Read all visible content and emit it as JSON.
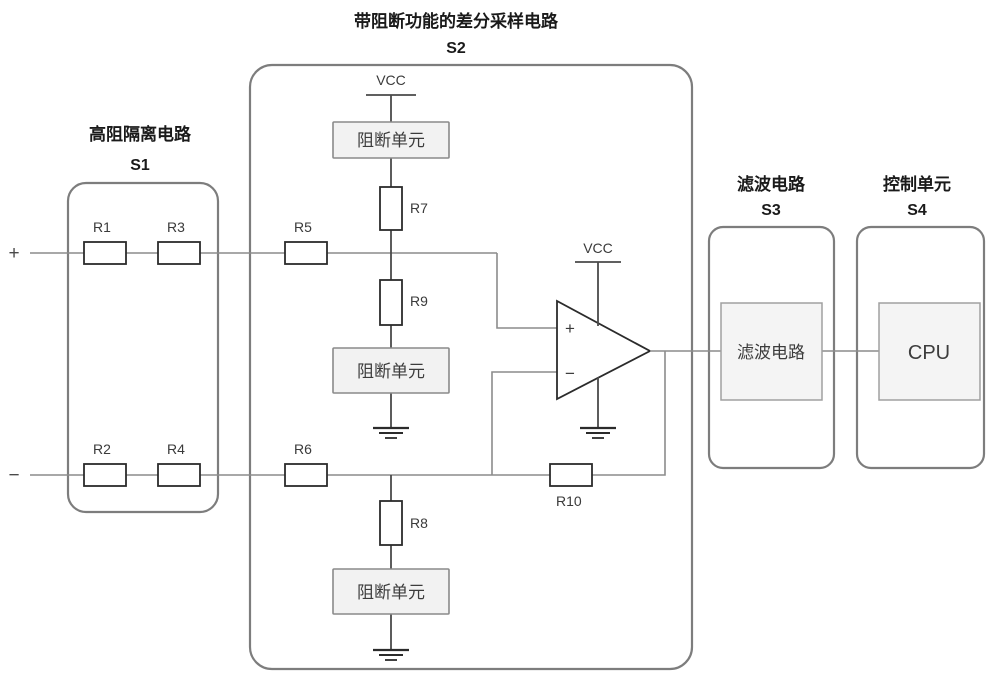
{
  "diagram": {
    "type": "circuit-block-diagram",
    "groups": [
      {
        "id": "S1",
        "title": "高阻隔离电路",
        "code": "S1"
      },
      {
        "id": "S2",
        "title": "带阻断功能的差分采样电路",
        "code": "S2"
      },
      {
        "id": "S3",
        "title": "滤波电路",
        "code": "S3"
      },
      {
        "id": "S4",
        "title": "控制单元",
        "code": "S4"
      }
    ],
    "terminals": {
      "positive": "+",
      "negative": "−"
    },
    "rails": {
      "vcc_top": "VCC",
      "vcc_opamp": "VCC"
    },
    "resistors": {
      "r1": "R1",
      "r2": "R2",
      "r3": "R3",
      "r4": "R4",
      "r5": "R5",
      "r6": "R6",
      "r7": "R7",
      "r8": "R8",
      "r9": "R9",
      "r10": "R10"
    },
    "blocking_units": {
      "top": "阻断单元",
      "middle": "阻断单元",
      "bottom": "阻断单元"
    },
    "blocks": {
      "filter": "滤波电路",
      "cpu": "CPU"
    },
    "opamp": {
      "plus": "+",
      "minus": "−"
    },
    "colors": {
      "wire": "#8c8c8c",
      "component_outline": "#2b2b2b",
      "group_outline": "#7d7d7d",
      "unit_fill": "#f2f2f2",
      "background": "#ffffff",
      "text": "#3a3a3a"
    }
  }
}
